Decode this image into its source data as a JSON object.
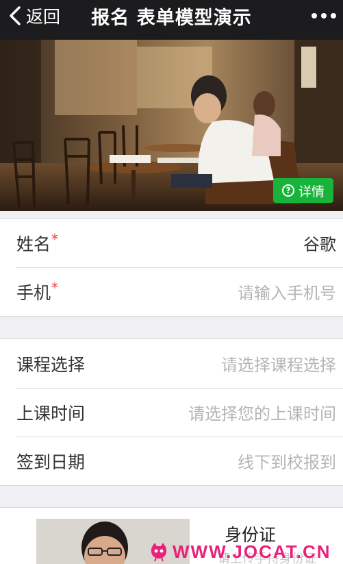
{
  "header": {
    "back_label": "返回",
    "title": "报名 表单模型演示",
    "more_icon": "more-dots-icon"
  },
  "banner": {
    "detail_label": "详情",
    "detail_icon": "question-circle-icon",
    "detail_color": "#18b33a"
  },
  "form": {
    "group1": [
      {
        "label": "姓名",
        "required": "*",
        "value": "谷歌"
      },
      {
        "label": "手机",
        "required": "*",
        "placeholder": "请输入手机号"
      }
    ],
    "group2": [
      {
        "label": "课程选择",
        "placeholder": "请选择课程选择"
      },
      {
        "label": "上课时间",
        "placeholder": "请选择您的上课时间"
      },
      {
        "label": "签到日期",
        "placeholder": "线下到校报到"
      }
    ]
  },
  "id_card": {
    "title": "身份证",
    "subtitle": "请上传手持身份证"
  },
  "watermark": {
    "text": "WWW.JOCAT.CN"
  },
  "colors": {
    "header_bg": "#1c1c1e",
    "required": "#e64340",
    "watermark": "#e8217a"
  }
}
